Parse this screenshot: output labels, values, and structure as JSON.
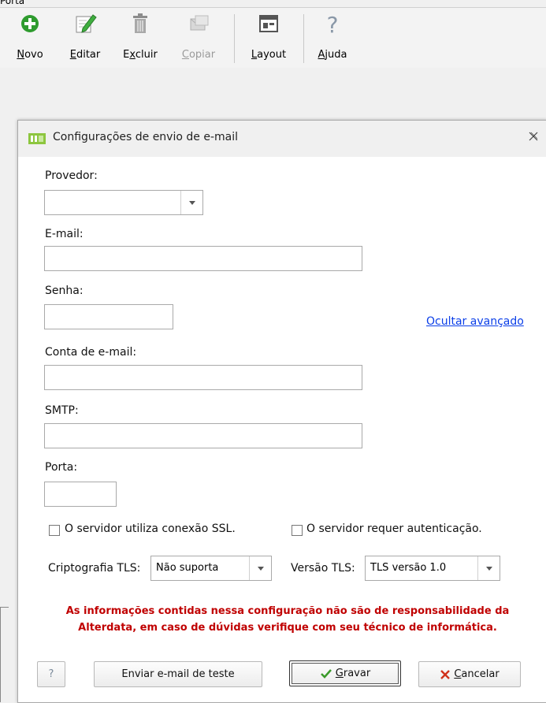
{
  "window": {
    "partial_title": "Porta"
  },
  "toolbar": {
    "buttons": [
      {
        "label_pre": "",
        "label_u": "N",
        "label_post": "ovo",
        "icon": "add-icon",
        "enabled": true
      },
      {
        "label_pre": "",
        "label_u": "E",
        "label_post": "ditar",
        "icon": "pencil-icon",
        "enabled": true
      },
      {
        "label_pre": "E",
        "label_u": "x",
        "label_post": "cluir",
        "icon": "trash-icon",
        "enabled": true
      },
      {
        "label_pre": "",
        "label_u": "C",
        "label_post": "opiar",
        "icon": "copy-mail-icon",
        "enabled": false
      },
      {
        "label_pre": "",
        "label_u": "L",
        "label_post": "ayout",
        "icon": "layout-icon",
        "enabled": true
      },
      {
        "label_pre": "",
        "label_u": "A",
        "label_post": "juda",
        "icon": "help-icon",
        "enabled": true
      }
    ]
  },
  "dialog": {
    "title": "Configurações de envio de e-mail",
    "provider": {
      "label": "Provedor:",
      "value": ""
    },
    "email": {
      "label": "E-mail:",
      "value": ""
    },
    "password": {
      "label": "Senha:",
      "value": ""
    },
    "advanced_link": "Ocultar avançado",
    "account": {
      "label": "Conta de e-mail:",
      "value": ""
    },
    "smtp": {
      "label": "SMTP:",
      "value": ""
    },
    "port": {
      "label": "Porta:",
      "value": ""
    },
    "ssl_checkbox": {
      "label": "O servidor utiliza conexão SSL.",
      "checked": false
    },
    "auth_checkbox": {
      "label": "O servidor requer autenticação.",
      "checked": false
    },
    "tls_crypto": {
      "label": "Criptografia TLS:",
      "value": "Não suporta"
    },
    "tls_version": {
      "label": "Versão TLS:",
      "value": "TLS versão 1.0"
    },
    "warning": {
      "line1": "As informações contidas nessa configuração não são de responsabilidade da",
      "line2": "Alterdata, em caso de dúvidas verifique com seu técnico de informática."
    },
    "buttons": {
      "help": "?",
      "test": "Enviar e-mail de teste",
      "save_u": "G",
      "save_rest": "ravar",
      "cancel_u": "C",
      "cancel_rest": "ancelar"
    }
  }
}
